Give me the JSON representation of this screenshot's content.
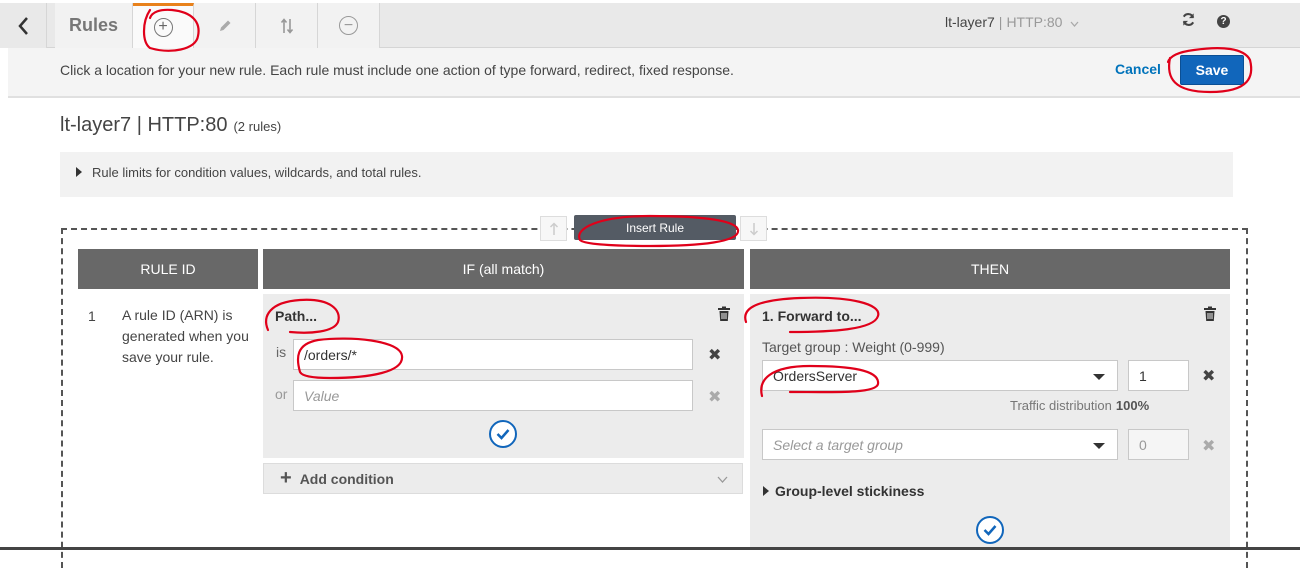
{
  "toolbar": {
    "rules_label": "Rules",
    "load_balancer": "lt-layer7",
    "separator": "|",
    "listener": "HTTP:80"
  },
  "info": {
    "text": "Click a location for your new rule. Each rule must include one action of type forward, redirect, fixed response.",
    "cancel": "Cancel",
    "save": "Save"
  },
  "page": {
    "title": "lt-layer7 | HTTP:80",
    "rule_count": "(2 rules)"
  },
  "limits": {
    "text": "Rule limits for condition values, wildcards, and total rules."
  },
  "insert_rule": "Insert Rule",
  "columns": {
    "rule_id": "RULE ID",
    "if": "IF (all match)",
    "then": "THEN"
  },
  "rule": {
    "number": "1",
    "description": "A rule ID (ARN) is generated when you save your rule."
  },
  "condition": {
    "name": "Path...",
    "is_label": "is",
    "or_label": "or",
    "value": "/orders/*",
    "value_placeholder": "Value",
    "add_condition": "Add condition"
  },
  "action": {
    "name": "1. Forward to...",
    "target_label": "Target group : Weight (0-999)",
    "target_group": "OrdersServer",
    "weight": "1",
    "traffic_label": "Traffic distribution",
    "traffic_value": "100%",
    "select_placeholder": "Select a target group",
    "weight2": "0",
    "stickiness": "Group-level stickiness"
  },
  "colors": {
    "accent": "#1166bb",
    "header": "#686868",
    "annotation": "#e0001a"
  }
}
